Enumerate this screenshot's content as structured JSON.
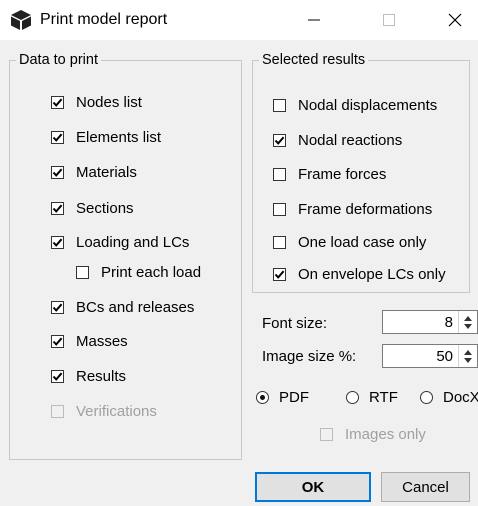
{
  "window": {
    "title": "Print model report",
    "icon": "cube-icon",
    "controls": {
      "minimize": "minimize-icon",
      "maximize": "maximize-icon",
      "close": "close-icon"
    }
  },
  "data_to_print": {
    "legend": "Data to print",
    "items": [
      {
        "label": "Nodes list",
        "checked": true,
        "enabled": true
      },
      {
        "label": "Elements list",
        "checked": true,
        "enabled": true
      },
      {
        "label": "Materials",
        "checked": true,
        "enabled": true
      },
      {
        "label": "Sections",
        "checked": true,
        "enabled": true
      },
      {
        "label": "Loading and LCs",
        "checked": true,
        "enabled": true
      },
      {
        "label": "Print each load",
        "checked": false,
        "enabled": true
      },
      {
        "label": "BCs and releases",
        "checked": true,
        "enabled": true
      },
      {
        "label": "Masses",
        "checked": true,
        "enabled": true
      },
      {
        "label": "Results",
        "checked": true,
        "enabled": true
      },
      {
        "label": "Verifications",
        "checked": false,
        "enabled": false
      }
    ]
  },
  "selected_results": {
    "legend": "Selected results",
    "items": [
      {
        "label": "Nodal displacements",
        "checked": false,
        "enabled": true
      },
      {
        "label": "Nodal reactions",
        "checked": true,
        "enabled": true
      },
      {
        "label": "Frame forces",
        "checked": false,
        "enabled": true
      },
      {
        "label": "Frame deformations",
        "checked": false,
        "enabled": true
      },
      {
        "label": "One load case only",
        "checked": false,
        "enabled": true
      },
      {
        "label": "On envelope LCs only",
        "checked": true,
        "enabled": true
      }
    ]
  },
  "font_size": {
    "label": "Font size:",
    "value": "8"
  },
  "image_size": {
    "label": "Image size %:",
    "value": "50"
  },
  "format": {
    "options": [
      "PDF",
      "RTF",
      "DocX"
    ],
    "selected": "PDF"
  },
  "images_only": {
    "label": "Images only",
    "checked": false,
    "enabled": false
  },
  "buttons": {
    "ok": "OK",
    "cancel": "Cancel"
  }
}
